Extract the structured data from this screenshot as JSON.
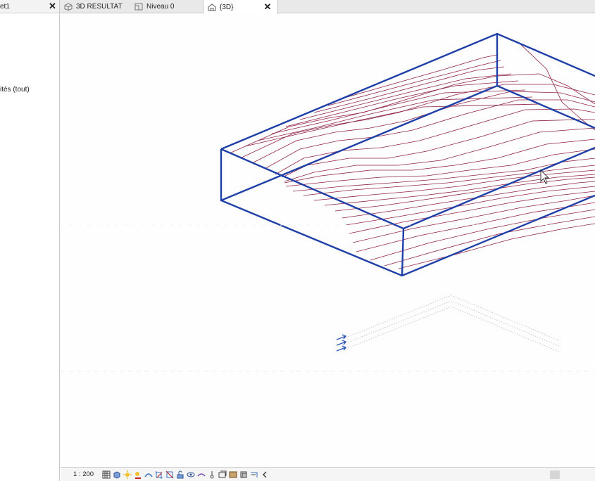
{
  "left_panel": {
    "tab_label": "et1",
    "property_text": "ités (tout)"
  },
  "tabs": [
    {
      "label": "3D RESULTAT",
      "icon": "3d-view-icon",
      "active": false
    },
    {
      "label": "Niveau 0",
      "icon": "floor-plan-icon",
      "active": false
    },
    {
      "label": "{3D}",
      "icon": "3d-house-icon",
      "active": true
    }
  ],
  "status_bar": {
    "scale": "1 : 200",
    "icons": [
      "detail-level-icon",
      "visual-style-icon",
      "sun-path-icon",
      "shadows-icon",
      "rendering-icon",
      "crop-view-icon",
      "show-crop-region-icon",
      "unlock-3d-view-icon",
      "temporary-hide-icon",
      "reveal-hidden-icon",
      "temporary-properties-icon",
      "worksharing-icon",
      "analytical-model-icon",
      "highlight-displacement-icon",
      "expand-arrow-icon"
    ]
  },
  "colors": {
    "section_box": "#1f3fa8",
    "contours": "#8e2146",
    "tab_bar": "#e9e9e9"
  }
}
